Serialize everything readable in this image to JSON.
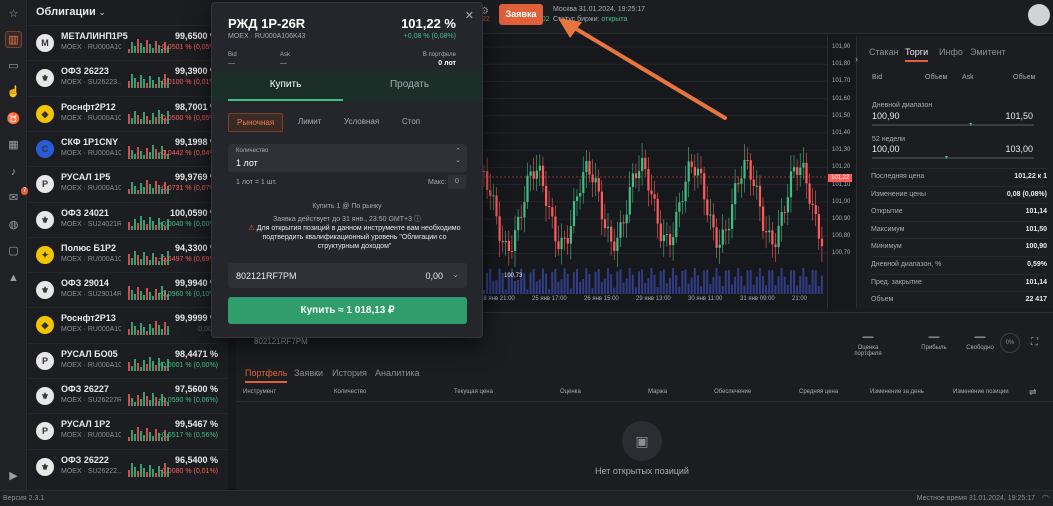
{
  "rail_icons": [
    "star-icon",
    "chart-icon",
    "briefcase-icon",
    "thumbs-up-icon",
    "bull-icon",
    "calendar-list-icon",
    "bell-icon",
    "mail-icon",
    "globe-icon",
    "chat-icon",
    "graduation-icon",
    "video-icon"
  ],
  "rail_mail_badge": "7",
  "watchlist": {
    "title": "Облигации",
    "items": [
      {
        "name": "МЕТАЛИНП1Р5",
        "sub": "MOEX · RU000A10...",
        "price": "99,6500 %",
        "chg": "−0,0501 % (0,05%)",
        "dir": "neg",
        "logo": "М",
        "logo_bg": "#e8e8e8"
      },
      {
        "name": "ОФЗ 26223",
        "sub": "MOEX · SU26223...",
        "price": "99,3900 %",
        "chg": "−0,0100 % (0,01%)",
        "dir": "neg",
        "logo": "⚜",
        "logo_bg": "#e8e8e8"
      },
      {
        "name": "Роснфт2Р12",
        "sub": "MOEX · RU000A10...",
        "price": "98,7001 %",
        "chg": "−0,0500 % (0,05%)",
        "dir": "neg",
        "logo": "◆",
        "logo_bg": "#f5c400"
      },
      {
        "name": "СКФ 1Р1CNY",
        "sub": "MOEX · RU000A10...",
        "price": "99,1998 %",
        "chg": "−0,0442 % (0,04%)",
        "dir": "neg",
        "logo": "С",
        "logo_bg": "#2a5bd7"
      },
      {
        "name": "РУСАЛ 1Р5",
        "sub": "MOEX · RU000A10...",
        "price": "99,9769 %",
        "chg": "−0,0731 % (0,07%)",
        "dir": "neg",
        "logo": "Р",
        "logo_bg": "#e8e8e8"
      },
      {
        "name": "ОФЗ 24021",
        "sub": "MOEX · SU24021R...",
        "price": "100,0590 %",
        "chg": "+0,0040 % (0,00%)",
        "dir": "pos",
        "logo": "⚜",
        "logo_bg": "#e8e8e8"
      },
      {
        "name": "Полюс Б1Р2",
        "sub": "MOEX · RU000A10...",
        "price": "94,3300 %",
        "chg": "−0,6497 % (0,69%)",
        "dir": "neg",
        "logo": "✦",
        "logo_bg": "#f5c400"
      },
      {
        "name": "ОФЗ 29014",
        "sub": "MOEX · SU29014R...",
        "price": "99,9940 %",
        "chg": "+0,0960 % (0,10%)",
        "dir": "pos",
        "logo": "⚜",
        "logo_bg": "#e8e8e8"
      },
      {
        "name": "Роснфт2Р13",
        "sub": "MOEX · RU000A10...",
        "price": "99,9999 %",
        "chg": "0,00%",
        "dir": "dim",
        "logo": "◆",
        "logo_bg": "#f5c400"
      },
      {
        "name": "РУСАЛ БО05",
        "sub": "MOEX · RU000A10...",
        "price": "98,4471 %",
        "chg": "+0,0001 % (0,00%)",
        "dir": "pos",
        "logo": "Р",
        "logo_bg": "#e8e8e8"
      },
      {
        "name": "ОФЗ 26227",
        "sub": "MOEX · SU26227R...",
        "price": "97,5600 %",
        "chg": "+0,0590 % (0,06%)",
        "dir": "pos",
        "logo": "⚜",
        "logo_bg": "#e8e8e8"
      },
      {
        "name": "РУСАЛ 1Р2",
        "sub": "MOEX · RU000A10...",
        "price": "99,5467 %",
        "chg": "+0,5517 % (0,56%)",
        "dir": "pos",
        "logo": "Р",
        "logo_bg": "#e8e8e8"
      },
      {
        "name": "ОФЗ 26222",
        "sub": "MOEX · SU26222...",
        "price": "96,5400 %",
        "chg": "−0,0080 % (0,01%)",
        "dir": "neg",
        "logo": "⚜",
        "logo_bg": "#e8e8e8"
      }
    ]
  },
  "topbar": {
    "order_btn": "Заявка",
    "datetime": "Москва 31.01.2024, 19:25:17",
    "exchange_label": "Статус биржи:",
    "exchange_status": "открыта",
    "bid_frag": "22",
    "ask_frag": "1602"
  },
  "modal": {
    "title": "РЖД 1Р-26R",
    "subtitle": "MOEX · RU000A106K43",
    "price": "101,22 %",
    "change": "+0,08 % (0,08%)",
    "bid_label": "Bid",
    "bid_val": "—",
    "ask_label": "Ask",
    "ask_val": "—",
    "portfolio_label": "В портфеле",
    "portfolio_val": "0 лот",
    "tab_buy": "Купить",
    "tab_sell": "Продать",
    "types": [
      "Рыночная",
      "Лимит",
      "Условная",
      "Стоп"
    ],
    "qty_label": "Количество",
    "qty_value": "1 лот",
    "lot_info": "1 лот = 1 шт.",
    "max_label": "Макс:",
    "max_value": "0",
    "info1": "Купить 1 @ По рынку",
    "info2": "Заявка действует до 31 янв., 23:50 GMT+3",
    "warning": "Для открытия позиций в данном инструменте вам необходимо подтвердить квалификационный уровень \"Облигации со структурным доходом\"",
    "account": "802121RF7PM",
    "account_val": "0,00",
    "submit": "Купить ≈ 1 018,13 ₽"
  },
  "chart_data": {
    "type": "candlestick",
    "y_ticks": [
      "101,90",
      "101,80",
      "101,70",
      "101,60",
      "101,50",
      "101,40",
      "101,30",
      "101,20",
      "101,10",
      "101,00",
      "100,90",
      "100,80",
      "100,70"
    ],
    "x_ticks": [
      "18 янв 21:00",
      "25 янв 17:00",
      "26 янв 15:00",
      "29 янв 13:00",
      "30 янв 11:00",
      "31 янв 09:00",
      "21:00"
    ],
    "last_price": "101,22",
    "low_label": "100,73"
  },
  "right_panel": {
    "tabs": [
      "Стакан",
      "Торги",
      "Инфо",
      "Эмитент"
    ],
    "active": "Торги",
    "bid": "Bid",
    "vol": "Объем",
    "ask": "Ask",
    "vol2": "Объем",
    "day_range_label": "Дневной диапазон",
    "day_lo": "100,90",
    "day_hi": "101,50",
    "week52_label": "52 недели",
    "w_lo": "100,00",
    "w_hi": "103,00",
    "stats": [
      [
        "Последняя цена",
        "101,22 к 1"
      ],
      [
        "Изменение цены",
        "0,08 (0,08%)"
      ],
      [
        "Открытие",
        "101,14"
      ],
      [
        "Максимум",
        "101,50"
      ],
      [
        "Минимум",
        "100,90"
      ],
      [
        "Дневной диапазон, %",
        "0,59%"
      ],
      [
        "Пред. закрытие",
        "101,14"
      ],
      [
        "Объем",
        "22 417"
      ]
    ]
  },
  "bottom": {
    "account": "802121RF7PM",
    "tabs": [
      "Портфель",
      "Заявки",
      "История",
      "Аналитика"
    ],
    "cols": [
      "Инструмент",
      "Количество",
      "Текущая цена",
      "Оценка",
      "Маржа",
      "Обеспечение",
      "Средняя цена",
      "Изменение за день",
      "Изменение позиции"
    ],
    "metrics": [
      [
        "—",
        "Оценка портфеля"
      ],
      [
        "—",
        "Прибыль"
      ],
      [
        "—",
        "Свободно"
      ]
    ],
    "pct": "0%",
    "empty": "Нет открытых позиций"
  },
  "status": {
    "version": "Версия 2.3.1",
    "time": "Местное время 31.01.2024, 19:25:17"
  },
  "colors": {
    "accent": "#e0603a",
    "up": "#3fbf86",
    "down": "#ff5b5b"
  }
}
